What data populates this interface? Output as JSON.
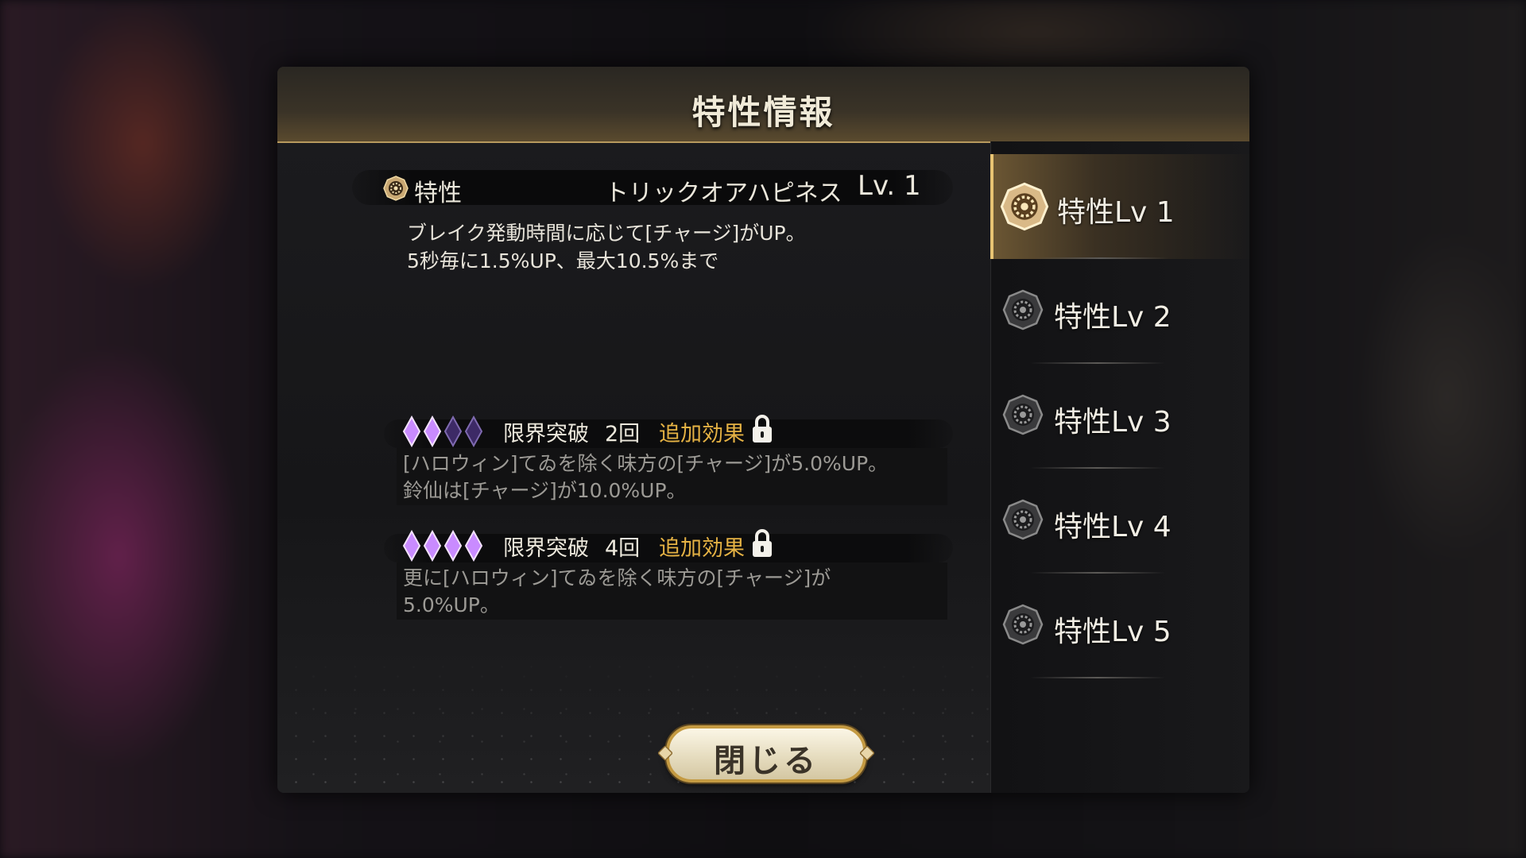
{
  "dialog": {
    "title": "特性情報",
    "close_label": "閉じる"
  },
  "trait": {
    "label": "特性",
    "name": "トリックオアハピネス",
    "level": "Lv. 1",
    "description": "ブレイク発動時間に応じて[チャージ]がUP。\n5秒毎に1.5%UP、最大10.5%まで",
    "icon": "trait-gear-icon"
  },
  "limit_breaks": [
    {
      "gems_filled": 2,
      "gems_total": 4,
      "label": "限界突破",
      "count": "2回",
      "extra_label": "追加効果",
      "locked": true,
      "description": "[ハロウィン]てゐを除く味方の[チャージ]が5.0%UP。\n鈴仙は[チャージ]が10.0%UP。"
    },
    {
      "gems_filled": 4,
      "gems_total": 4,
      "label": "限界突破",
      "count": "4回",
      "extra_label": "追加効果",
      "locked": true,
      "description": "更に[ハロウィン]てゐを除く味方の[チャージ]が\n5.0%UP。"
    }
  ],
  "levels": [
    {
      "label": "特性Lv 1",
      "active": true
    },
    {
      "label": "特性Lv 2",
      "active": false
    },
    {
      "label": "特性Lv 3",
      "active": false
    },
    {
      "label": "特性Lv 4",
      "active": false
    },
    {
      "label": "特性Lv 5",
      "active": false
    }
  ],
  "colors": {
    "accent_gold": "#e5b244",
    "gem_purple": "#a25cf0",
    "text_main": "#ece8dc",
    "text_muted": "#9c9a95"
  }
}
